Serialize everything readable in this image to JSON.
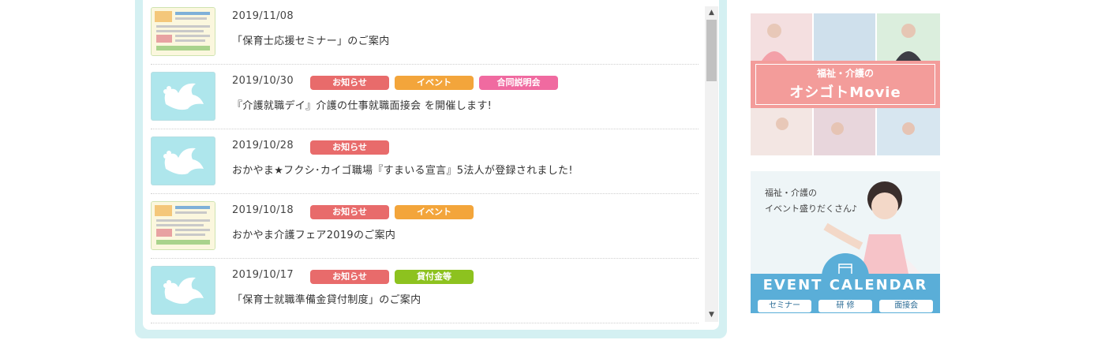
{
  "colors": {
    "panel_border": "#d4f0f2",
    "tag_news": "#e86b6b",
    "tag_event": "#f3a53b",
    "tag_briefing": "#f06aa0",
    "tag_loan": "#8dc21f",
    "thumb_bg": "#aee6ec"
  },
  "news": [
    {
      "date": "2019/11/08",
      "title": "「保育士応援セミナー」のご案内",
      "thumb": "flyer",
      "tags": []
    },
    {
      "date": "2019/10/30",
      "title": "『介護就職デイ』介護の仕事就職面接会 を開催します!",
      "thumb": "dove",
      "tags": [
        {
          "label": "お知らせ",
          "color": "#e86b6b"
        },
        {
          "label": "イベント",
          "color": "#f3a53b"
        },
        {
          "label": "合同説明会",
          "color": "#f06aa0"
        }
      ]
    },
    {
      "date": "2019/10/28",
      "title": "おかやま★フクシ･カイゴ職場『すまいる宣言』5法人が登録されました!",
      "thumb": "dove",
      "tags": [
        {
          "label": "お知らせ",
          "color": "#e86b6b"
        }
      ]
    },
    {
      "date": "2019/10/18",
      "title": "おかやま介護フェア2019のご案内",
      "thumb": "flyer",
      "tags": [
        {
          "label": "お知らせ",
          "color": "#e86b6b"
        },
        {
          "label": "イベント",
          "color": "#f3a53b"
        }
      ]
    },
    {
      "date": "2019/10/17",
      "title": "「保育士就職準備金貸付制度」のご案内",
      "thumb": "dove",
      "tags": [
        {
          "label": "お知らせ",
          "color": "#e86b6b"
        },
        {
          "label": "貸付金等",
          "color": "#8dc21f"
        }
      ]
    }
  ],
  "banners": {
    "movie": {
      "sub": "福祉・介護の",
      "main": "オシゴトMovie"
    },
    "event": {
      "handwriting_line1": "福祉・介護の",
      "handwriting_line2": "イベント盛りだくさん♪",
      "title": "EVENT CALENDAR",
      "pills": [
        "セミナー",
        "研 修",
        "面接会"
      ]
    }
  },
  "icons": {
    "scroll_up": "chevron-up-icon",
    "scroll_down": "chevron-down-icon"
  }
}
